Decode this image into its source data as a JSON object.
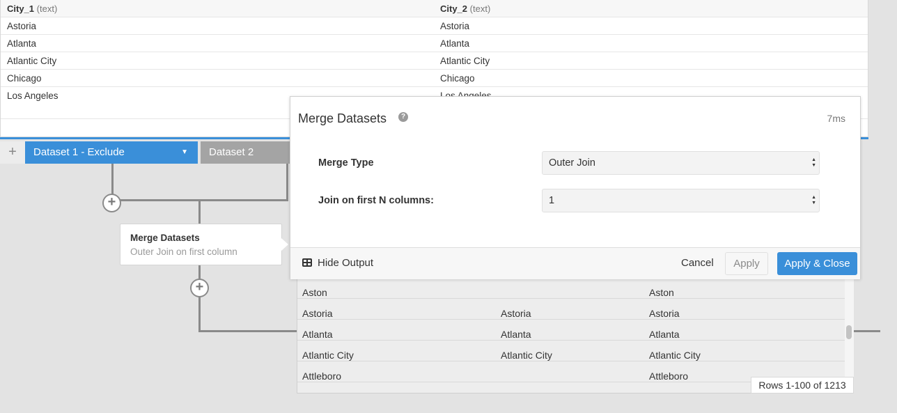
{
  "top_table": {
    "headers": [
      {
        "name": "City_1",
        "type": "(text)"
      },
      {
        "name": "City_2",
        "type": "(text)"
      }
    ],
    "rows": [
      [
        "Astoria",
        "Astoria"
      ],
      [
        "Atlanta",
        "Atlanta"
      ],
      [
        "Atlantic City",
        "Atlantic City"
      ],
      [
        "Chicago",
        "Chicago"
      ],
      [
        "Los Angeles",
        "Los Angeles"
      ]
    ]
  },
  "tabs": {
    "add_label": "+",
    "active": "Dataset 1 - Exclude",
    "active_caret": "▼",
    "second": "Dataset 2"
  },
  "node": {
    "title": "Merge Datasets",
    "subtitle": "Outer Join on first column"
  },
  "dialog": {
    "title": "Merge Datasets",
    "help": "?",
    "timing": "7ms",
    "merge_type_label": "Merge Type",
    "merge_type_value": "Outer Join",
    "join_label": "Join on first N columns:",
    "join_value": "1",
    "hide_output": "Hide Output",
    "cancel": "Cancel",
    "apply": "Apply",
    "apply_close": "Apply & Close"
  },
  "output_table": {
    "rows": [
      [
        "Aston",
        "",
        "Aston"
      ],
      [
        "Astoria",
        "Astoria",
        "Astoria"
      ],
      [
        "Atlanta",
        "Atlanta",
        "Atlanta"
      ],
      [
        "Atlantic City",
        "Atlantic City",
        "Atlantic City"
      ],
      [
        "Attleboro",
        "",
        "Attleboro"
      ]
    ],
    "rows_badge": "Rows 1-100 of 1213"
  },
  "colors": {
    "accent": "#3a8fd9",
    "inactive_tab": "#a4a4a4",
    "canvas": "#e3e3e3"
  },
  "icons": {
    "help": "help-icon",
    "table": "table-icon",
    "plus": "plus-icon",
    "caret": "chevron-down-icon"
  }
}
